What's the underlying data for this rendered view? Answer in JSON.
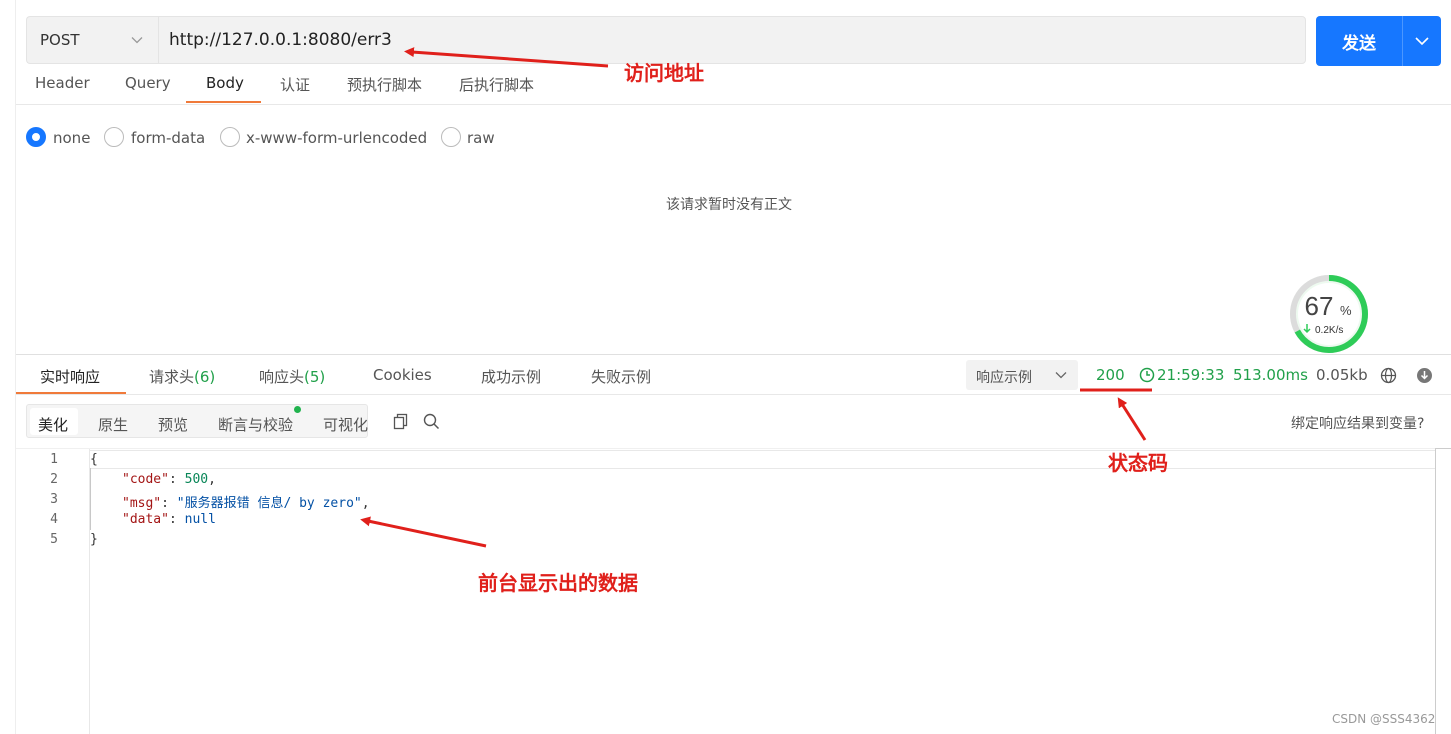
{
  "request": {
    "method": "POST",
    "url": "http://127.0.0.1:8080/err3",
    "send_label": "发送"
  },
  "request_tabs": [
    {
      "label": "Header"
    },
    {
      "label": "Query"
    },
    {
      "label": "Body"
    },
    {
      "label": "认证"
    },
    {
      "label": "预执行脚本"
    },
    {
      "label": "后执行脚本"
    }
  ],
  "active_request_tab": "Body",
  "body_types": [
    {
      "label": "none",
      "selected": true
    },
    {
      "label": "form-data",
      "selected": false
    },
    {
      "label": "x-www-form-urlencoded",
      "selected": false
    },
    {
      "label": "raw",
      "selected": false
    }
  ],
  "empty_body_text": "该请求暂时没有正文",
  "speed": {
    "percent": 67,
    "percent_unit": "%",
    "rate": "0.2K/s"
  },
  "response_tabs": [
    {
      "label": "实时响应"
    },
    {
      "label": "请求头",
      "count": "(6)"
    },
    {
      "label": "响应头",
      "count": "(5)"
    },
    {
      "label": "Cookies"
    },
    {
      "label": "成功示例"
    },
    {
      "label": "失败示例"
    }
  ],
  "response_example_label": "响应示例",
  "status": {
    "code": "200",
    "time": "21:59:33",
    "duration": "513.00ms",
    "size": "0.05kb"
  },
  "view_modes": [
    {
      "label": "美化"
    },
    {
      "label": "原生"
    },
    {
      "label": "预览"
    },
    {
      "label": "断言与校验"
    },
    {
      "label": "可视化"
    }
  ],
  "bind_result_label": "绑定响应结果到变量?",
  "code_lines": {
    "l1": {
      "num": "1",
      "text": "{"
    },
    "l2": {
      "num": "2",
      "key": "\"code\"",
      "colon": ": ",
      "value": "500",
      "tail": ","
    },
    "l3": {
      "num": "3",
      "key": "\"msg\"",
      "colon": ": ",
      "value": "\"服务器报错 信息/ by zero\"",
      "tail": ","
    },
    "l4": {
      "num": "4",
      "key": "\"data\"",
      "colon": ": ",
      "value": "null",
      "tail": ""
    },
    "l5": {
      "num": "5",
      "text": "}"
    }
  },
  "annotations": {
    "url": "访问地址",
    "status": "状态码",
    "data": "前台显示出的数据"
  },
  "watermark": "CSDN @SSS4362",
  "colors": {
    "accent": "#1677ff",
    "tab_underline": "#f07a3a",
    "status_ok": "#21a04a",
    "annotation": "#e0201b"
  }
}
